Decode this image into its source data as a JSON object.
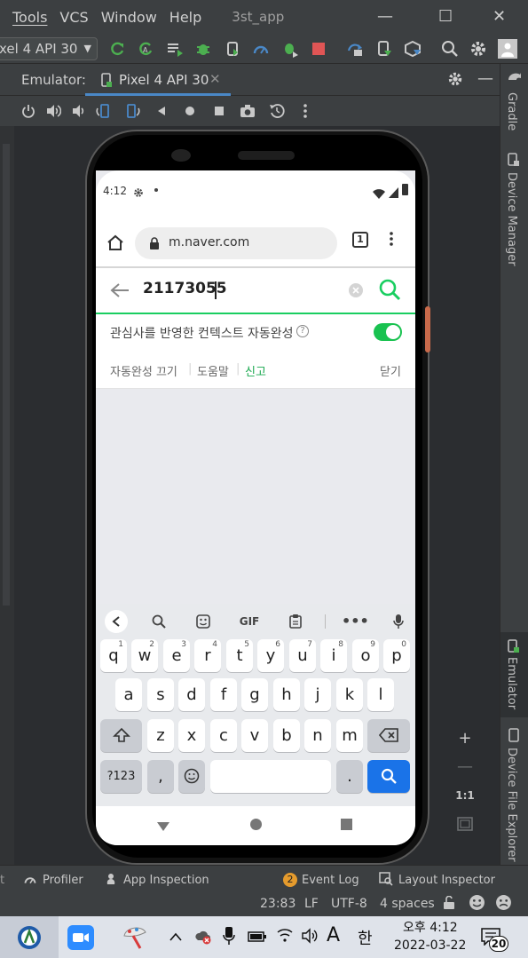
{
  "menubar": {
    "items": [
      "Tools",
      "VCS",
      "Window",
      "Help"
    ],
    "project": "3st_app",
    "controls": {
      "minimize": "—",
      "maximize": "☐",
      "close": "✕"
    }
  },
  "toolbar": {
    "device": "xel 4 API 30",
    "colors": {
      "green": "#4caf50",
      "red": "#e05555",
      "blue": "#4a88c7"
    }
  },
  "emulator_panel": {
    "label": "Emulator:",
    "tab_name": "Pixel 4 API 30"
  },
  "right_strip": {
    "gradle": "Gradle",
    "device_manager": "Device Manager",
    "emulator": "Emulator",
    "device_file_explorer": "Device File Explorer",
    "zoom_ratio": "1:1"
  },
  "phone": {
    "status_time": "4:12",
    "url": "m.naver.com",
    "tab_count": "1",
    "search_query": "21173055",
    "autocomplete_text": "관심사를 반영한 컨텍스트 자동완성",
    "autocomplete_on": true,
    "links": {
      "off": "자동완성 끄기",
      "help": "도움말",
      "report": "신고",
      "close": "닫기"
    },
    "accent_green": "#19ce60",
    "keyboard": {
      "gif_label": "GIF",
      "row1": [
        "q",
        "w",
        "e",
        "r",
        "t",
        "y",
        "u",
        "i",
        "o",
        "p"
      ],
      "row1_hints": [
        "1",
        "2",
        "3",
        "4",
        "5",
        "6",
        "7",
        "8",
        "9",
        "0"
      ],
      "row2": [
        "a",
        "s",
        "d",
        "f",
        "g",
        "h",
        "j",
        "k",
        "l"
      ],
      "row3": [
        "z",
        "x",
        "c",
        "v",
        "b",
        "n",
        "m"
      ],
      "num_label": "?123",
      "comma": ",",
      "period": ".",
      "search_key_color": "#1a73e8"
    }
  },
  "bottom_tools": {
    "profiler": "Profiler",
    "app_inspection": "App Inspection",
    "event_log_badge": "2",
    "event_log": "Event Log",
    "layout_inspector": "Layout Inspector"
  },
  "status": {
    "position": "23:83",
    "line_sep": "LF",
    "encoding": "UTF-8",
    "indent": "4 spaces"
  },
  "taskbar": {
    "ime_a": "A",
    "ime_han": "한",
    "time": "오후 4:12",
    "date": "2022-03-22",
    "notifications": "20"
  }
}
